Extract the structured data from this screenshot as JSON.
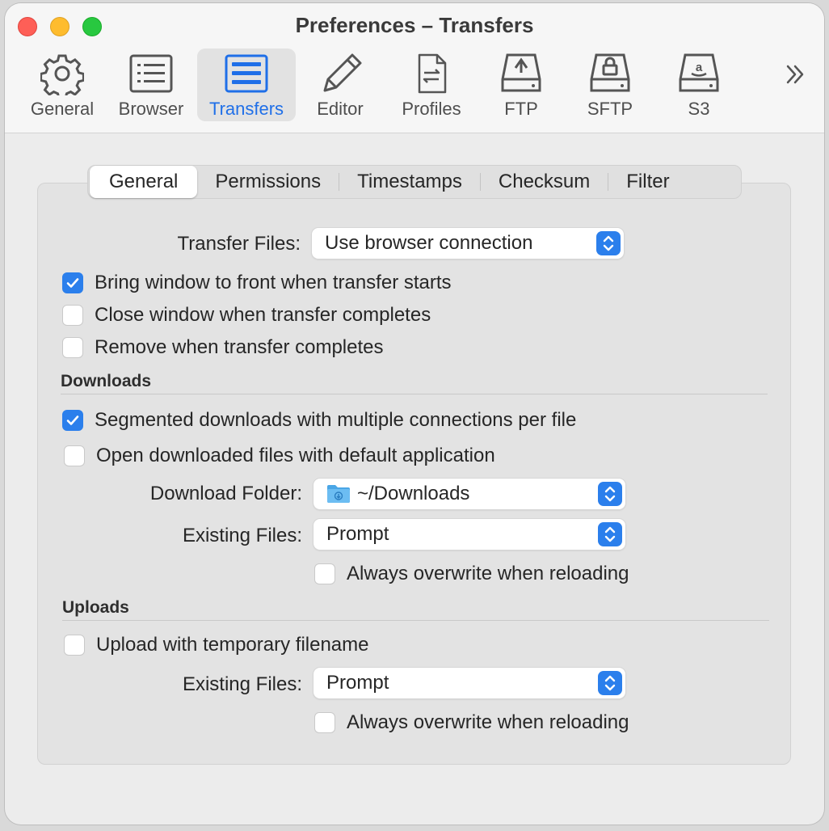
{
  "window": {
    "title": "Preferences – Transfers"
  },
  "toolbar": {
    "items": [
      {
        "label": "General",
        "icon": "gear-icon"
      },
      {
        "label": "Browser",
        "icon": "list-icon"
      },
      {
        "label": "Transfers",
        "icon": "transfers-icon",
        "active": true
      },
      {
        "label": "Editor",
        "icon": "pencil-icon"
      },
      {
        "label": "Profiles",
        "icon": "profiles-icon"
      },
      {
        "label": "FTP",
        "icon": "ftp-drive-icon"
      },
      {
        "label": "SFTP",
        "icon": "sftp-drive-icon"
      },
      {
        "label": "S3",
        "icon": "s3-drive-icon"
      }
    ],
    "more_icon": "chevron-double-right-icon"
  },
  "tabs": [
    "General",
    "Permissions",
    "Timestamps",
    "Checksum",
    "Filter"
  ],
  "selected_tab": "General",
  "general": {
    "transfer_files_label": "Transfer Files:",
    "transfer_files_value": "Use browser connection",
    "bring_to_front": {
      "label": "Bring window to front when transfer starts",
      "checked": true
    },
    "close_window": {
      "label": "Close window when transfer completes",
      "checked": false
    },
    "remove_when_complete": {
      "label": "Remove when transfer completes",
      "checked": false
    }
  },
  "downloads": {
    "heading": "Downloads",
    "segmented": {
      "label": "Segmented downloads with multiple connections per file",
      "checked": true
    },
    "open_default": {
      "label": "Open downloaded files with default application",
      "checked": false
    },
    "folder_label": "Download Folder:",
    "folder_value": "~/Downloads",
    "existing_label": "Existing Files:",
    "existing_value": "Prompt",
    "overwrite": {
      "label": "Always overwrite when reloading",
      "checked": false
    }
  },
  "uploads": {
    "heading": "Uploads",
    "temp_filename": {
      "label": "Upload with temporary filename",
      "checked": false
    },
    "existing_label": "Existing Files:",
    "existing_value": "Prompt",
    "overwrite": {
      "label": "Always overwrite when reloading",
      "checked": false
    }
  },
  "colors": {
    "accent": "#2b7fec",
    "active_label": "#1f6fe8"
  }
}
